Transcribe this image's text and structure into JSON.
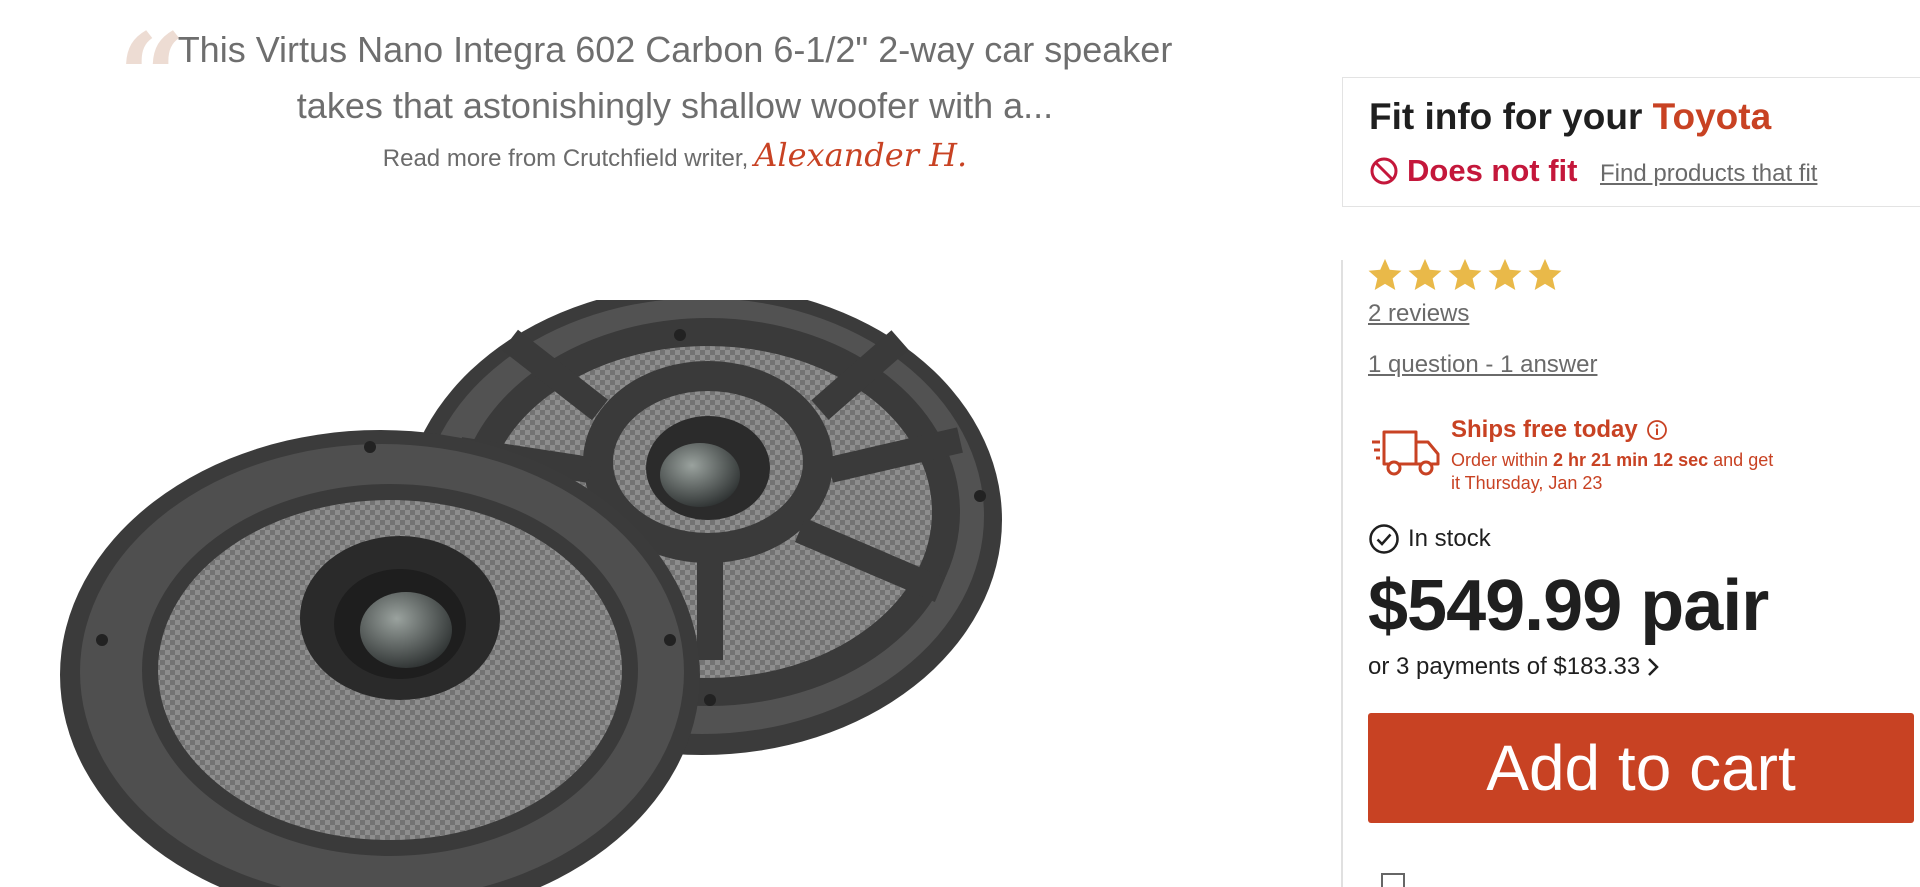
{
  "quote": {
    "text": "This Virtus Nano Integra 602 Carbon 6-1/2\" 2-way car speaker takes that astonishingly shallow woofer with a...",
    "byline_prefix": "Read more from Crutchfield writer,",
    "author": "Alexander H."
  },
  "fit": {
    "title_prefix": "Fit info for your",
    "vehicle": "Toyota",
    "status": "Does not fit",
    "link": "Find products that fit"
  },
  "rating": {
    "stars": 5,
    "max_stars": 5,
    "reviews_link": "2 reviews"
  },
  "qa_link": "1 question - 1 answer",
  "shipping": {
    "title": "Ships free today",
    "detail_prefix": "Order within",
    "time_left": "2 hr 21 min 12 sec",
    "detail_suffix": "and get it Thursday, Jan 23"
  },
  "stock": "In stock",
  "price": "$549.99 pair",
  "payments": "or 3 payments of $183.33",
  "cart_button": "Add to cart",
  "colors": {
    "accent": "#c84223",
    "fit_status": "#c4173b",
    "star": "#e9b949"
  },
  "icons": [
    "ban-icon",
    "star-icon",
    "truck-icon",
    "info-icon",
    "check-circle-icon",
    "chevron-right-icon",
    "list-icon"
  ]
}
